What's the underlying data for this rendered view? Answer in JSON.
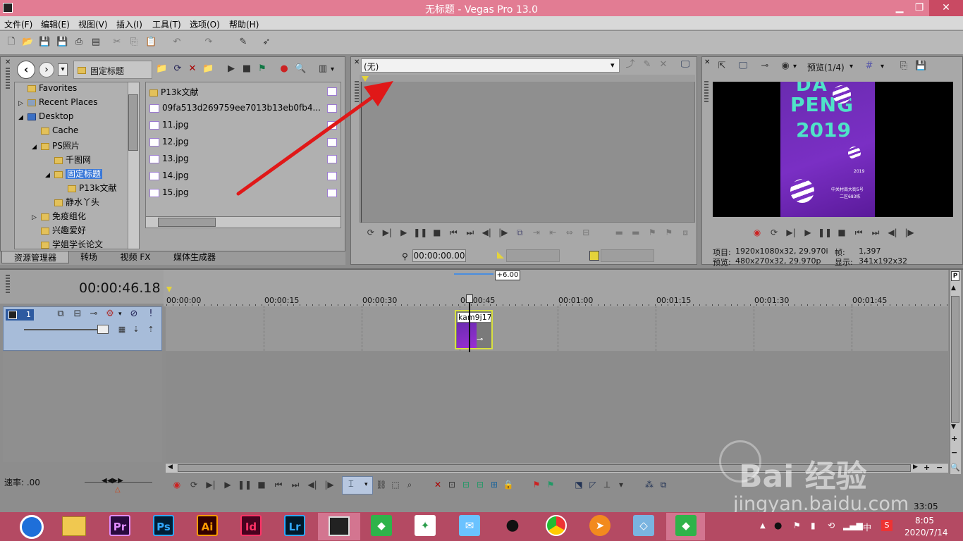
{
  "window": {
    "title": "无标题 - Vegas Pro 13.0"
  },
  "menu": [
    "文件(F)",
    "编辑(E)",
    "视图(V)",
    "插入(I)",
    "工具(T)",
    "选项(O)",
    "帮助(H)"
  ],
  "explorer": {
    "path": "固定标题",
    "tree": [
      {
        "label": "Favorites",
        "depth": 1
      },
      {
        "label": "Recent Places",
        "depth": 1
      },
      {
        "label": "Desktop",
        "depth": 1
      },
      {
        "label": "Cache",
        "depth": 2
      },
      {
        "label": "PS照片",
        "depth": 2
      },
      {
        "label": "千图网",
        "depth": 3
      },
      {
        "label": "固定标题",
        "depth": 3
      },
      {
        "label": "P13k文献",
        "depth": 4
      },
      {
        "label": "静水丫头",
        "depth": 3
      },
      {
        "label": "免疫组化",
        "depth": 2
      },
      {
        "label": "兴趣爱好",
        "depth": 2
      },
      {
        "label": "学姐学长论文",
        "depth": 2
      }
    ],
    "files": [
      "P13k文献",
      "09fa513d269759ee7013b13eb0fb4...",
      "11.jpg",
      "12.jpg",
      "13.jpg",
      "14.jpg",
      "15.jpg"
    ],
    "tabs": [
      "资源管理器",
      "转场",
      "视频 FX",
      "媒体生成器"
    ]
  },
  "trimmer": {
    "dropdown": "(无)",
    "timecode": "00:00:00.00"
  },
  "preview": {
    "mode_label": "预览(1/4)",
    "poster": {
      "line1": "DA",
      "line2": "PENG",
      "line3": "2019",
      "small1": "2019",
      "small2": "中关村南大街5号",
      "small3": "二区683栋"
    },
    "info": {
      "project_label": "项目:",
      "project_value": "1920x1080x32, 29.970i",
      "frame_label": "帧:",
      "frame_value": "1,397",
      "preview_label": "预览:",
      "preview_value": "480x270x32, 29.970p",
      "display_label": "显示:",
      "display_value": "341x192x32"
    }
  },
  "timeline": {
    "timecode": "00:00:46.18",
    "offset": "+6.00",
    "ticks": [
      "00:00:00",
      "00:00:15",
      "00:00:30",
      "00:00:45",
      "00:01:00",
      "00:01:15",
      "00:01:30",
      "00:01:45"
    ],
    "track_number": "1",
    "clip_name": "kam9j17",
    "rate_label": "速率: .00",
    "status_time": "33:05"
  },
  "watermark": {
    "brand": "Bai 经验",
    "url": "jingyan.baidu.com"
  },
  "taskbar": {
    "apps": [
      {
        "name": "Pr",
        "color": "#2a0a3e",
        "fg": "#e08cff"
      },
      {
        "name": "Ps",
        "color": "#001e36",
        "fg": "#31a8ff"
      },
      {
        "name": "Ai",
        "color": "#330000",
        "fg": "#ff9a00"
      },
      {
        "name": "Id",
        "color": "#49021f",
        "fg": "#ff3366"
      },
      {
        "name": "Lr",
        "color": "#001a2b",
        "fg": "#31a8ff"
      }
    ],
    "time": "8:05",
    "date": "2020/7/14",
    "ime": "中"
  }
}
